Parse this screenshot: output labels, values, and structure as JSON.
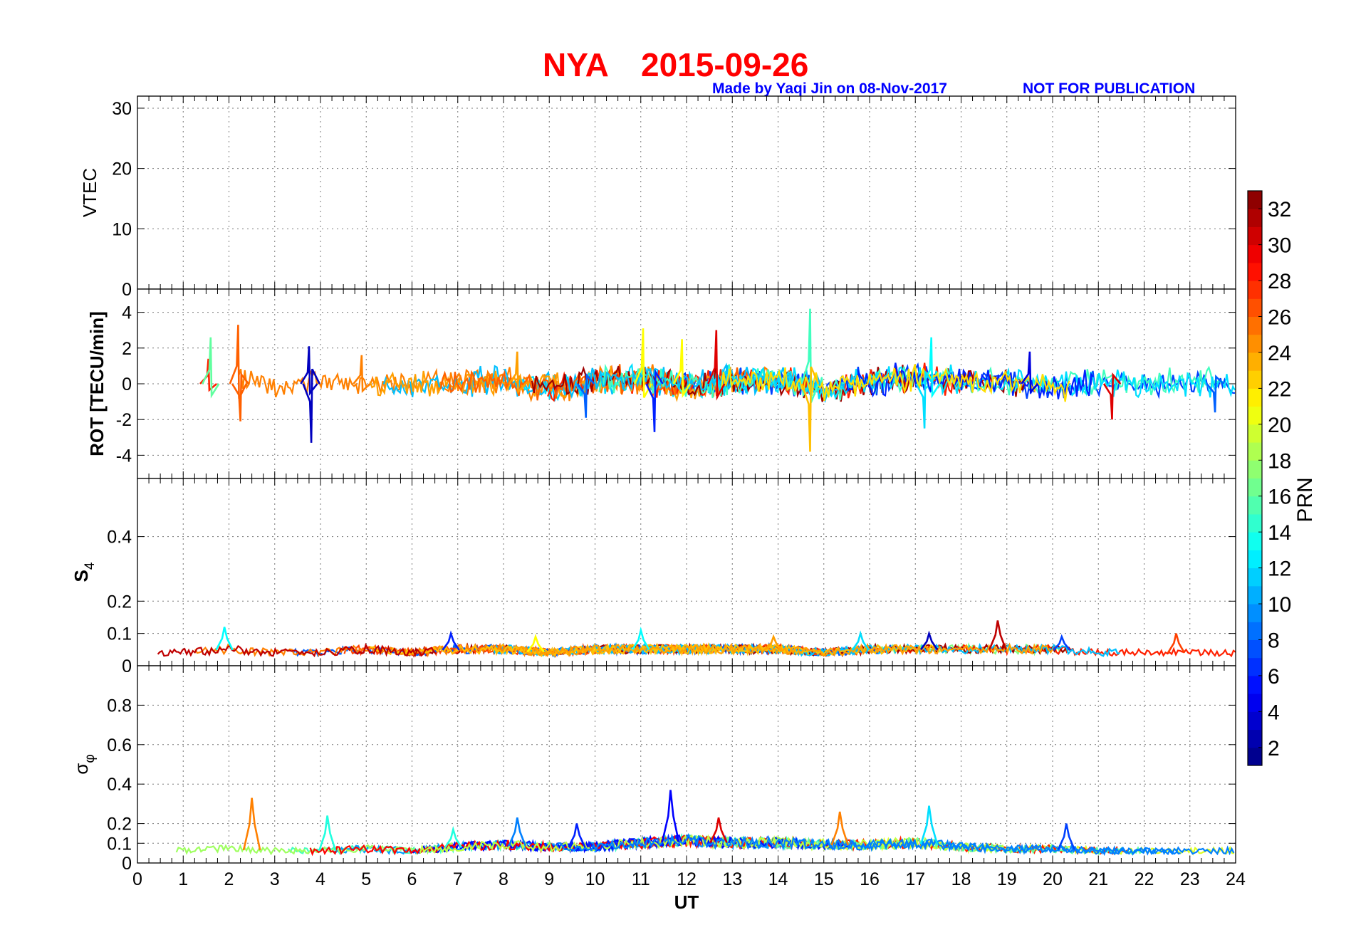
{
  "header": {
    "station": "NYA",
    "date": "2015-09-26",
    "credit": "Made by Yaqi Jin on 08-Nov-2017",
    "notice": "NOT FOR PUBLICATION"
  },
  "chart_data": [
    {
      "type": "line",
      "panel": "vtec",
      "ylabel": "VTEC",
      "xlim": [
        0,
        24
      ],
      "ylim": [
        0,
        32
      ],
      "yticks": [
        "0",
        "10",
        "20",
        "30"
      ],
      "grid": true,
      "series": []
    },
    {
      "type": "line",
      "panel": "rot",
      "ylabel": "ROT [TECU/min]",
      "xlim": [
        0,
        24
      ],
      "ylim": [
        -5.3,
        5.3
      ],
      "yticks": [
        "-4",
        "-2",
        "0",
        "2",
        "4"
      ],
      "grid": true,
      "color_by": "PRN",
      "series": [
        {
          "x": [
            0,
            1,
            2,
            3,
            4,
            5,
            6,
            7,
            8,
            9,
            10,
            11,
            12,
            13,
            14,
            15,
            16,
            17,
            18,
            19,
            20,
            21,
            22,
            23,
            24
          ],
          "y": [
            0.2,
            -0.3,
            0.5,
            -0.4,
            0.1,
            0.3,
            -0.2,
            0.1,
            0.4,
            -0.5,
            0.2,
            0.6,
            -0.3,
            0.4,
            0.5,
            -0.6,
            0.3,
            0.7,
            0.2,
            0.3,
            -0.4,
            0.2,
            0,
            0.1,
            0
          ]
        }
      ],
      "peaks": [
        {
          "x": 1.55,
          "y": 1.4,
          "prn": 28
        },
        {
          "x": 1.6,
          "y": 2.6,
          "prn": 16
        },
        {
          "x": 2.2,
          "y": 3.3,
          "prn": 26
        },
        {
          "x": 2.25,
          "y": -2.1,
          "prn": 26
        },
        {
          "x": 3.75,
          "y": 2.1,
          "prn": 3
        },
        {
          "x": 3.8,
          "y": -3.3,
          "prn": 3
        },
        {
          "x": 4.9,
          "y": 1.6,
          "prn": 25
        },
        {
          "x": 8.3,
          "y": 1.8,
          "prn": 24
        },
        {
          "x": 9.8,
          "y": -1.9,
          "prn": 8
        },
        {
          "x": 11.05,
          "y": 3.1,
          "prn": 21
        },
        {
          "x": 11.3,
          "y": -2.7,
          "prn": 6
        },
        {
          "x": 11.9,
          "y": 2.5,
          "prn": 21
        },
        {
          "x": 12.65,
          "y": 3.0,
          "prn": 30
        },
        {
          "x": 14.7,
          "y": 4.2,
          "prn": 15
        },
        {
          "x": 14.7,
          "y": -3.8,
          "prn": 23
        },
        {
          "x": 17.35,
          "y": 2.6,
          "prn": 13
        },
        {
          "x": 17.2,
          "y": -2.5,
          "prn": 12
        },
        {
          "x": 19.5,
          "y": 1.8,
          "prn": 4
        },
        {
          "x": 21.3,
          "y": -2.0,
          "prn": 30
        },
        {
          "x": 23.55,
          "y": -1.6,
          "prn": 8
        }
      ]
    },
    {
      "type": "line",
      "panel": "s4",
      "ylabel": "S",
      "ylabel_sub": "4",
      "xlim": [
        0,
        24
      ],
      "ylim": [
        0,
        0.58
      ],
      "yticks": [
        "0",
        "0.1",
        "0.2",
        "0.4"
      ],
      "grid": true,
      "color_by": "PRN",
      "series": [
        {
          "x": [
            0,
            1,
            2,
            3,
            4,
            5,
            6,
            7,
            8,
            9,
            10,
            11,
            12,
            13,
            14,
            15,
            16,
            17,
            18,
            19,
            20,
            21,
            22,
            23,
            24
          ],
          "y": [
            0.04,
            0.04,
            0.05,
            0.04,
            0.04,
            0.05,
            0.04,
            0.05,
            0.05,
            0.04,
            0.05,
            0.05,
            0.05,
            0.05,
            0.05,
            0.04,
            0.05,
            0.05,
            0.05,
            0.05,
            0.05,
            0.04,
            0.04,
            0.04,
            0.04
          ]
        }
      ],
      "peaks": [
        {
          "x": 1.9,
          "y": 0.12,
          "prn": 13
        },
        {
          "x": 6.85,
          "y": 0.1,
          "prn": 6
        },
        {
          "x": 8.7,
          "y": 0.09,
          "prn": 21
        },
        {
          "x": 11.0,
          "y": 0.11,
          "prn": 13
        },
        {
          "x": 13.9,
          "y": 0.09,
          "prn": 24
        },
        {
          "x": 15.8,
          "y": 0.1,
          "prn": 12
        },
        {
          "x": 17.3,
          "y": 0.1,
          "prn": 3
        },
        {
          "x": 18.8,
          "y": 0.14,
          "prn": 31
        },
        {
          "x": 20.2,
          "y": 0.09,
          "prn": 7
        },
        {
          "x": 22.7,
          "y": 0.1,
          "prn": 27
        }
      ]
    },
    {
      "type": "line",
      "panel": "sigma_phi",
      "ylabel": "σ",
      "ylabel_sub": "φ",
      "xlabel": "UT",
      "xlim": [
        0,
        24
      ],
      "ylim": [
        0,
        1.0
      ],
      "yticks": [
        "0",
        "0.1",
        "0.2",
        "0.4",
        "0.6",
        "0.8"
      ],
      "xticks": [
        "0",
        "1",
        "2",
        "3",
        "4",
        "5",
        "6",
        "7",
        "8",
        "9",
        "10",
        "11",
        "12",
        "13",
        "14",
        "15",
        "16",
        "17",
        "18",
        "19",
        "20",
        "21",
        "22",
        "23",
        "24"
      ],
      "grid": true,
      "color_by": "PRN",
      "series": [
        {
          "x": [
            0,
            1,
            2,
            3,
            4,
            5,
            6,
            7,
            8,
            9,
            10,
            11,
            12,
            13,
            14,
            15,
            16,
            17,
            18,
            19,
            20,
            21,
            22,
            23,
            24
          ],
          "y": [
            0.07,
            0.06,
            0.07,
            0.06,
            0.06,
            0.07,
            0.06,
            0.08,
            0.09,
            0.08,
            0.08,
            0.1,
            0.11,
            0.1,
            0.1,
            0.09,
            0.09,
            0.1,
            0.08,
            0.07,
            0.07,
            0.06,
            0.06,
            0.06,
            0.06
          ]
        }
      ],
      "peaks": [
        {
          "x": 2.5,
          "y": 0.33,
          "prn": 25
        },
        {
          "x": 4.15,
          "y": 0.24,
          "prn": 14
        },
        {
          "x": 6.9,
          "y": 0.17,
          "prn": 14
        },
        {
          "x": 8.3,
          "y": 0.23,
          "prn": 9
        },
        {
          "x": 9.6,
          "y": 0.2,
          "prn": 6
        },
        {
          "x": 11.65,
          "y": 0.37,
          "prn": 5
        },
        {
          "x": 12.7,
          "y": 0.23,
          "prn": 30
        },
        {
          "x": 15.35,
          "y": 0.26,
          "prn": 25
        },
        {
          "x": 17.3,
          "y": 0.29,
          "prn": 12
        },
        {
          "x": 20.3,
          "y": 0.2,
          "prn": 7
        }
      ]
    }
  ],
  "colorbar": {
    "label": "PRN",
    "range": [
      1,
      33
    ],
    "ticks": [
      "2",
      "4",
      "6",
      "8",
      "10",
      "12",
      "14",
      "16",
      "18",
      "20",
      "22",
      "24",
      "26",
      "28",
      "30",
      "32"
    ],
    "colormap": "jet",
    "colors": [
      "#00008f",
      "#0000ff",
      "#0080ff",
      "#00ffff",
      "#80ff80",
      "#ffff00",
      "#ff8000",
      "#ff0000",
      "#800000"
    ]
  }
}
